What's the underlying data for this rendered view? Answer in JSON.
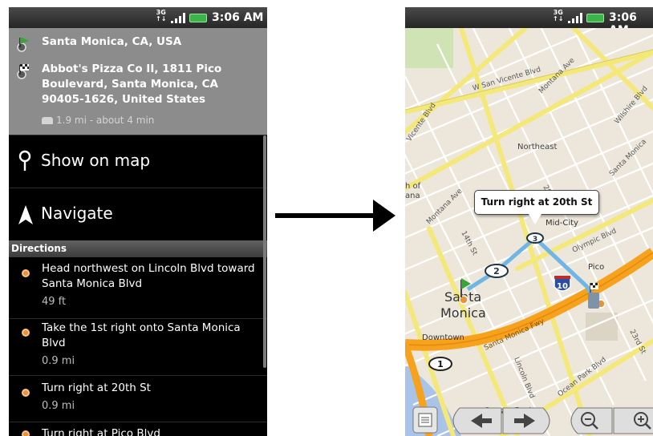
{
  "status_bar": {
    "network": "3G",
    "time": "3:06 AM"
  },
  "route": {
    "origin": "Santa Monica, CA, USA",
    "destination": "Abbot's Pizza Co II, 1811 Pico Boulevard, Santa Monica, CA 90405-1626, United States",
    "summary": "1.9 mi - about 4 min"
  },
  "menu": {
    "show_on_map": "Show on map",
    "navigate": "Navigate"
  },
  "directions": {
    "header": "Directions",
    "steps": [
      {
        "text": "Head northwest on Lincoln Blvd toward Santa Monica Blvd",
        "distance": "49 ft"
      },
      {
        "text": "Take the 1st right onto Santa Monica Blvd",
        "distance": "0.9 mi"
      },
      {
        "text": "Turn right at 20th St",
        "distance": "0.9 mi"
      },
      {
        "text": "Turn right at Pico Blvd",
        "distance": ""
      }
    ]
  },
  "map": {
    "callout": "Turn right at 20th St",
    "labels": {
      "san_vicente": "W San Vicente Blvd",
      "montana": "Montana Ave",
      "wilshire": "Wilshire Blvd",
      "vicente_left": "Vicente Blvd",
      "northeast": "Northeast",
      "santa_monica_blvd": "Santa Monica",
      "h_of": "h of",
      "ana": "ana",
      "montana_ave_2": "Montana Ave",
      "fourteenth": "14th St",
      "mid_city": "Mid-City",
      "twentieth": "20th",
      "olympic": "Olympic Blvd",
      "pico": "Pico",
      "santa_monica_city": "Santa",
      "monica_city": "Monica",
      "downtown": "Downtown",
      "sm_fwy": "Santa Monica Fwy",
      "lincoln": "Lincoln Blvd",
      "ocean_park_blvd": "Ocean Park Blvd",
      "twentythird": "23rd St",
      "ocean_park": "Ocean Park",
      "i10": "10"
    },
    "markers": [
      "1",
      "2",
      "3"
    ]
  },
  "colors": {
    "route_line": "#6fb6e6",
    "highway": "#f6a21d",
    "major_road": "#f4e87a",
    "step_dot": "#e8923a",
    "battery": "#39b54a"
  }
}
